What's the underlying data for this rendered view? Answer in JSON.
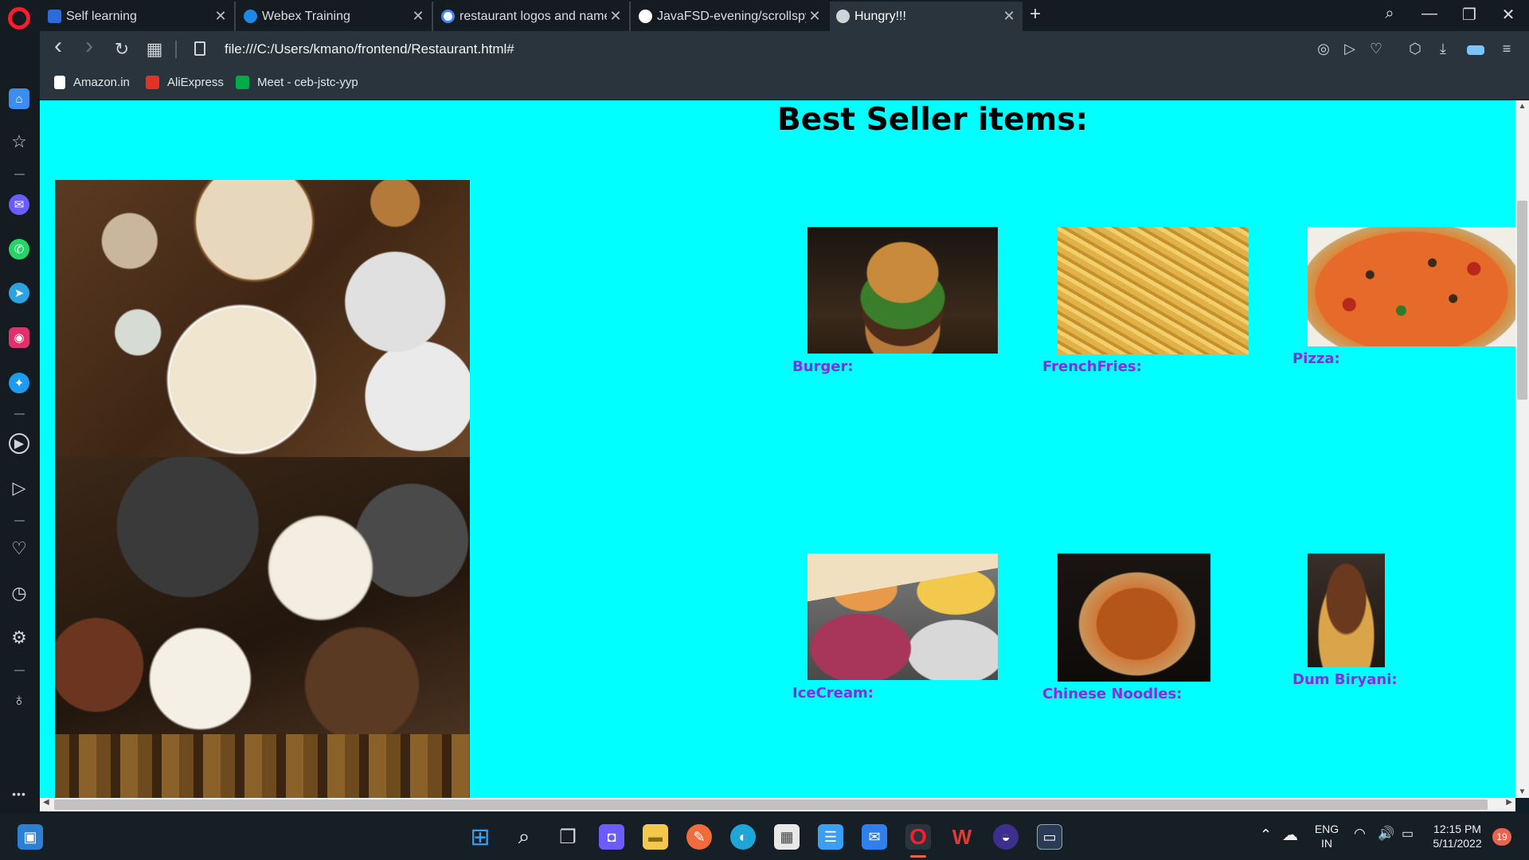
{
  "browser": {
    "tabs": [
      {
        "title": "Self learning",
        "favicon_color": "#2b6cd8",
        "active": false
      },
      {
        "title": "Webex Training",
        "favicon_color": "#1e88e5",
        "active": false
      },
      {
        "title": "restaurant logos and name",
        "favicon_color": "#ffffff",
        "active": false
      },
      {
        "title": "JavaFSD-evening/scrollspy.",
        "favicon_color": "#ffffff",
        "active": false
      },
      {
        "title": "Hungry!!!",
        "favicon_color": "#cfd4d8",
        "active": true
      }
    ],
    "url": "file:///C:/Users/kmano/frontend/Restaurant.html#",
    "bookmarks": [
      {
        "label": "Amazon.in",
        "icon_color": "#ffffff"
      },
      {
        "label": "AliExpress",
        "icon_color": "#e43225"
      },
      {
        "label": "Meet - ceb-jstc-yyp",
        "icon_color": "#00ac47"
      }
    ],
    "icons": {
      "new_tab": "+",
      "search": "⌕",
      "minimize": "—",
      "restore": "❐",
      "close": "✕",
      "back": "‹",
      "forward": "›",
      "reload": "↻",
      "tabs_grid": "▦",
      "snapshot": "◎",
      "send": "▷",
      "heart": "♡",
      "cube": "⬡",
      "download": "⤓",
      "easy_setup": "≡"
    }
  },
  "sidebar": {
    "items": [
      {
        "name": "home",
        "glyph": "⌂",
        "color": "#3b8df0"
      },
      {
        "name": "speed-dial",
        "glyph": "☆",
        "color": ""
      },
      {
        "name": "messenger",
        "glyph": "✉",
        "color": "#6b5cff"
      },
      {
        "name": "whatsapp",
        "glyph": "✆",
        "color": "#25d366"
      },
      {
        "name": "telegram",
        "glyph": "➤",
        "color": "#2aa3e0"
      },
      {
        "name": "instagram",
        "glyph": "◉",
        "color": "#e1306c"
      },
      {
        "name": "twitter",
        "glyph": "✦",
        "color": "#1d9bf0"
      },
      {
        "name": "player",
        "glyph": "▶",
        "color": ""
      },
      {
        "name": "flow",
        "glyph": "▷",
        "color": ""
      },
      {
        "name": "pinboards",
        "glyph": "♡",
        "color": ""
      },
      {
        "name": "history",
        "glyph": "◷",
        "color": ""
      },
      {
        "name": "settings",
        "glyph": "⚙",
        "color": ""
      },
      {
        "name": "tips",
        "glyph": "♁",
        "color": ""
      },
      {
        "name": "more",
        "glyph": "•••",
        "color": ""
      }
    ]
  },
  "page": {
    "heading": "Best Seller items:",
    "label_color": "#8a2be2",
    "background_color": "#00ffff",
    "items": [
      {
        "label": "Burger:"
      },
      {
        "label": "FrenchFries:"
      },
      {
        "label": "Pizza:"
      },
      {
        "label": "IceCream:"
      },
      {
        "label": "Chinese Noodles:"
      },
      {
        "label": "Dum Biryani:"
      }
    ]
  },
  "taskbar": {
    "apps": [
      {
        "name": "widgets",
        "glyph": "▣",
        "color": "#2d7fd3"
      },
      {
        "name": "start",
        "glyph": "⊞",
        "color": "#3aa0f5"
      },
      {
        "name": "search",
        "glyph": "⌕",
        "color": ""
      },
      {
        "name": "task-view",
        "glyph": "❐",
        "color": ""
      },
      {
        "name": "teams-chat",
        "glyph": "◘",
        "color": "#6b5cff"
      },
      {
        "name": "file-explorer",
        "glyph": "▬",
        "color": "#f2c94c"
      },
      {
        "name": "app-orange",
        "glyph": "✎",
        "color": "#f26b3a"
      },
      {
        "name": "edge",
        "glyph": "◐",
        "color": "#1fa6d8"
      },
      {
        "name": "store",
        "glyph": "▦",
        "color": "#e8e8e8"
      },
      {
        "name": "notepad",
        "glyph": "☰",
        "color": "#3aa0f5"
      },
      {
        "name": "mail",
        "glyph": "✉",
        "color": "#2f80ed"
      },
      {
        "name": "opera",
        "glyph": "O",
        "color": "#ff1b2d"
      },
      {
        "name": "wps-office",
        "glyph": "W",
        "color": "#e53935"
      },
      {
        "name": "eclipse",
        "glyph": "◒",
        "color": "#3d2f8f"
      },
      {
        "name": "mysql-client",
        "glyph": "▭",
        "color": "#2b3a55"
      }
    ],
    "tray": {
      "lang_line1": "ENG",
      "lang_line2": "IN",
      "time": "12:15 PM",
      "date": "5/11/2022",
      "notifications": "19"
    }
  }
}
